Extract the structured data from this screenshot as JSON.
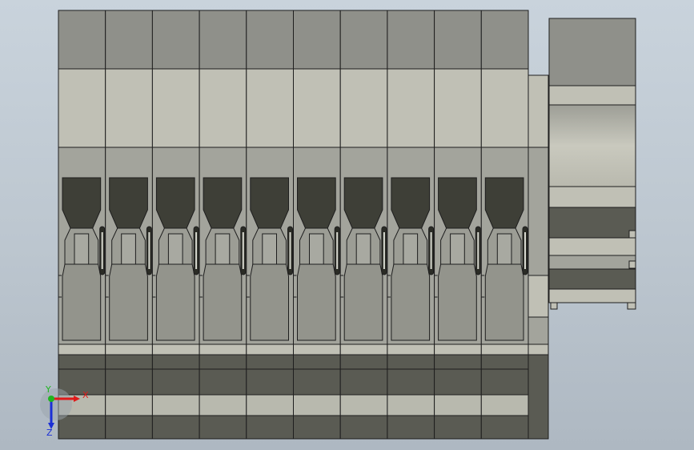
{
  "viewport": {
    "background_top": "#c9d3dc",
    "background_bottom": "#aeb8c2"
  },
  "model": {
    "module_count": 10,
    "colors": {
      "top_block": "#8f908a",
      "light_band": "#c0c0b5",
      "mid_band": "#a3a49c",
      "slot_dark": "#3e3f37",
      "slot_body": "#93948c",
      "slot_neck": "#9c9d95",
      "bottom_dark": "#5a5b53",
      "bottom_light": "#b8b9ae",
      "edge": "#1e1e1e"
    }
  },
  "triad": {
    "x_label": "X",
    "y_label": "Y",
    "z_label": "Z",
    "x_color": "#e01a1a",
    "y_color": "#1fb51f",
    "z_color": "#1a2fd6"
  }
}
